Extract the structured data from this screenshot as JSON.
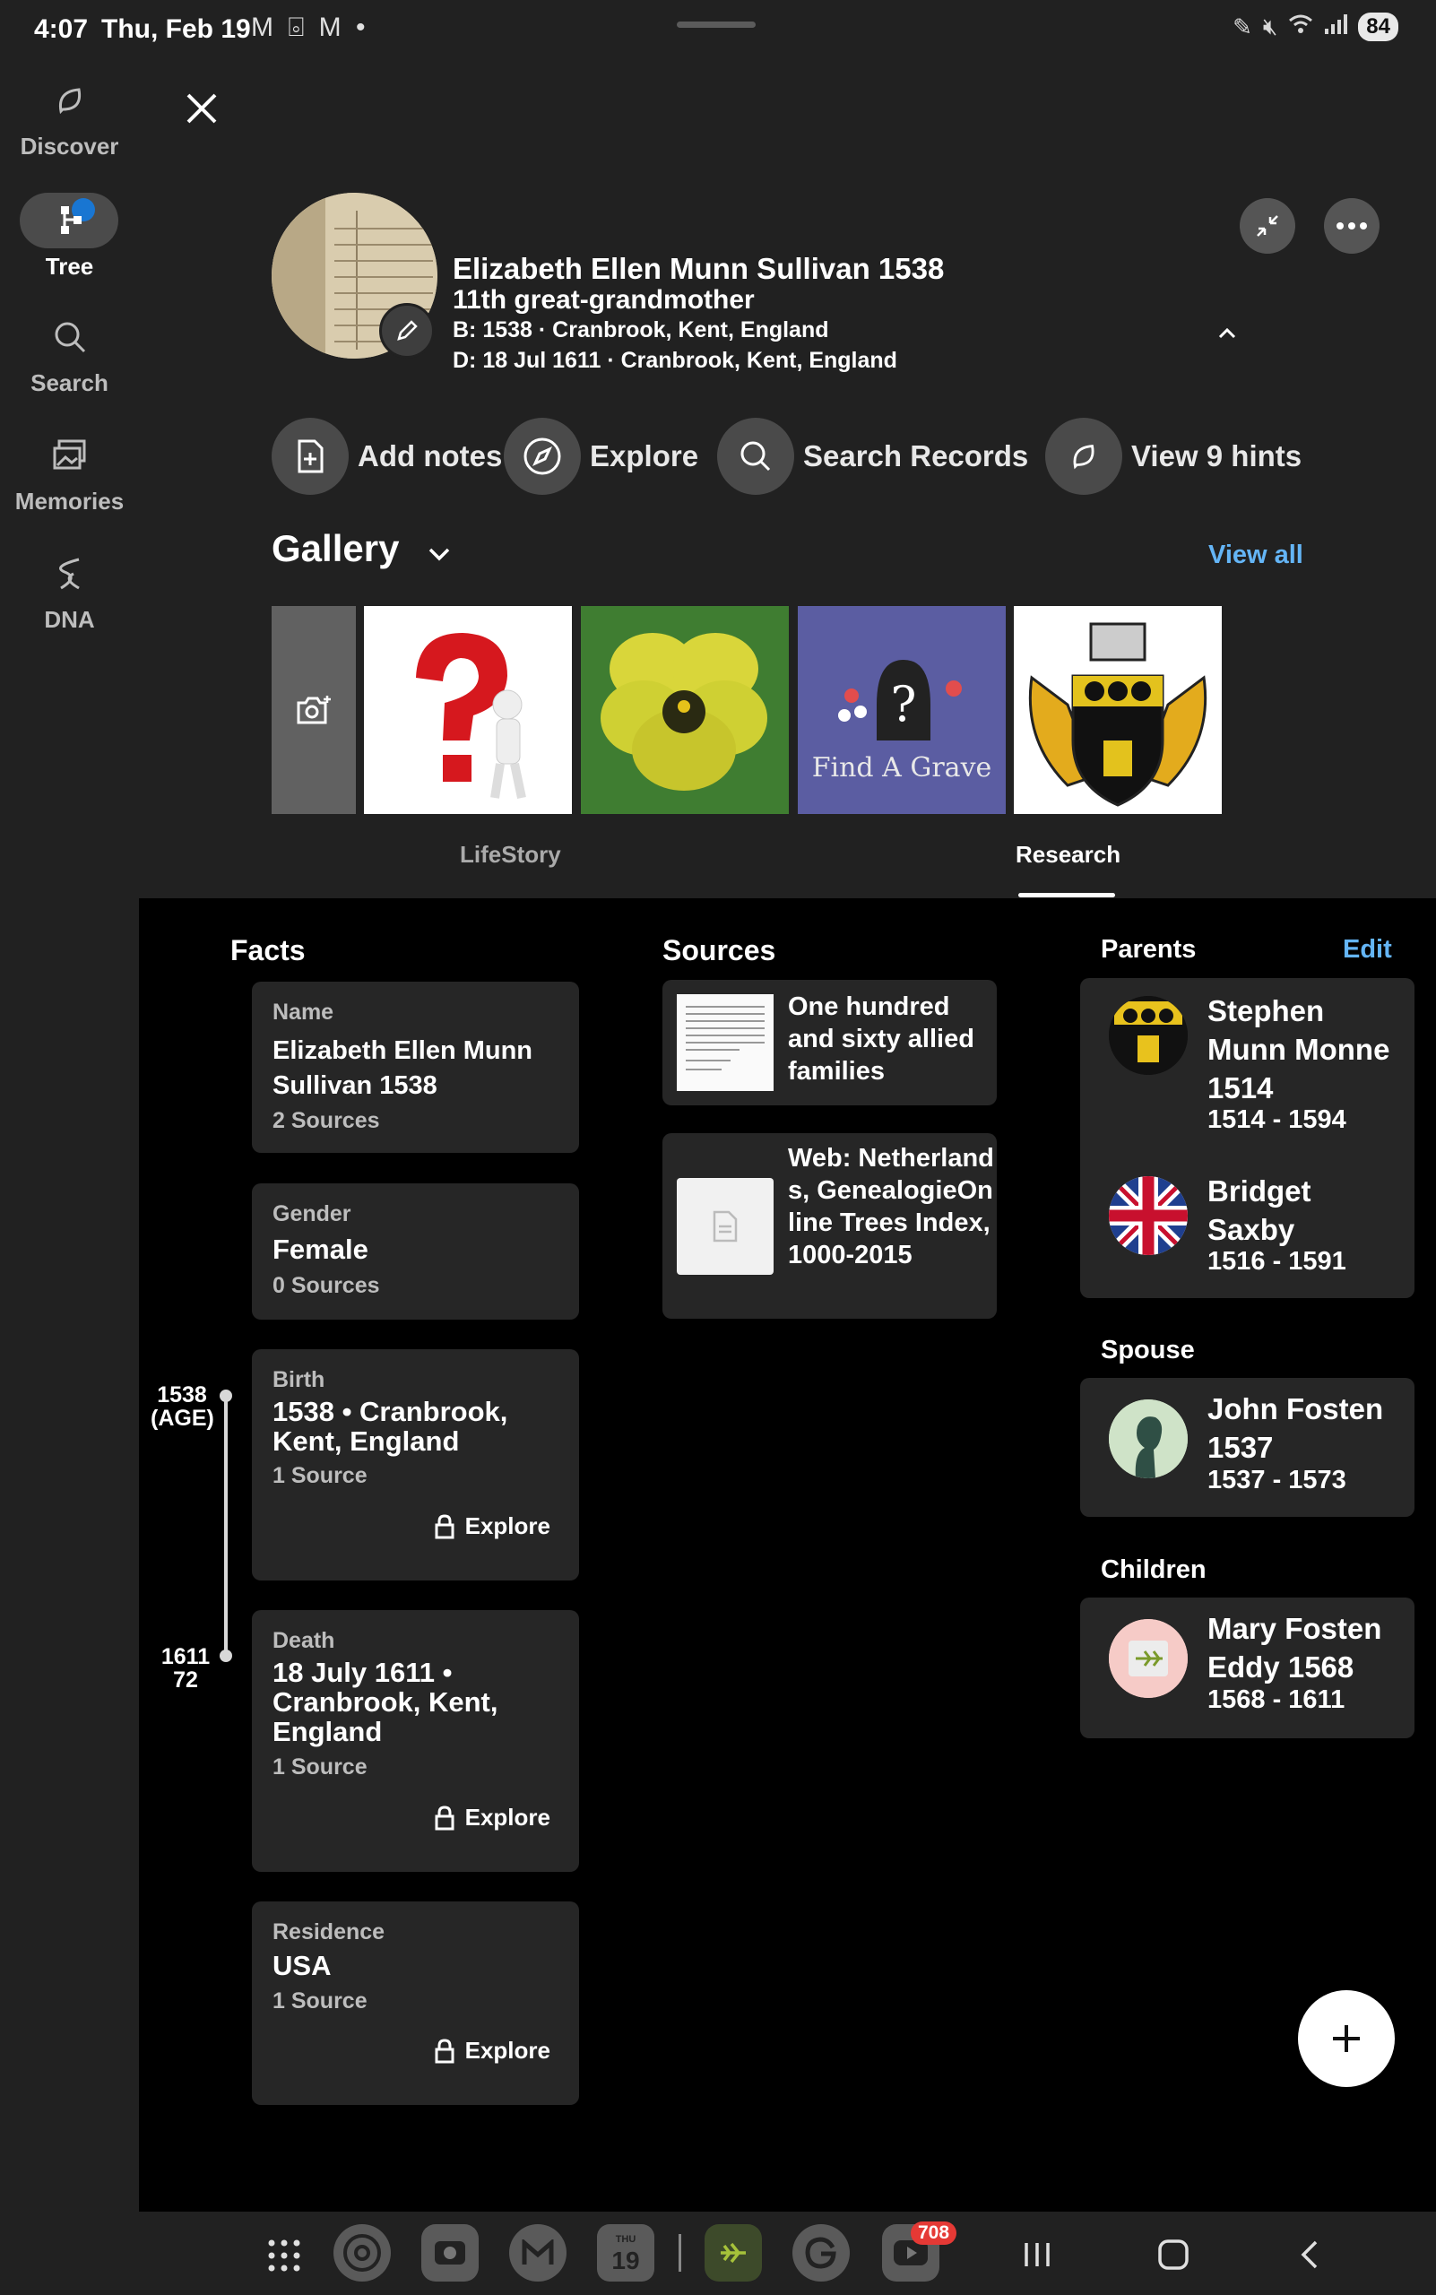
{
  "status_bar": {
    "time": "4:07",
    "date": "Thu, Feb 19",
    "left_icons": "M ⌻ M •",
    "battery": "84"
  },
  "rail": {
    "items": [
      {
        "label": "Discover",
        "icon": "hint-leaf-icon"
      },
      {
        "label": "Tree",
        "icon": "tree-icon"
      },
      {
        "label": "Search",
        "icon": "search-icon"
      },
      {
        "label": "Memories",
        "icon": "photos-icon"
      },
      {
        "label": "DNA",
        "icon": "dna-icon"
      }
    ]
  },
  "person": {
    "name": "Elizabeth Ellen Munn Sullivan 1538",
    "relationship": "11th great-grandmother",
    "birth": "B: 1538 · Cranbrook, Kent, England",
    "death": "D: 18 Jul 1611 · Cranbrook, Kent, England"
  },
  "actions": [
    {
      "label": "Add notes",
      "icon": "add-note-icon"
    },
    {
      "label": "Explore",
      "icon": "compass-icon"
    },
    {
      "label": "Search Records",
      "icon": "search-icon"
    },
    {
      "label": "View 9 hints",
      "icon": "hint-leaf-icon"
    }
  ],
  "gallery": {
    "title": "Gallery",
    "view_all": "View all",
    "thumb_findagrave_text": "Find A Grave"
  },
  "tabs": {
    "lifestory": "LifeStory",
    "research": "Research",
    "active": "Research"
  },
  "facts": {
    "heading": "Facts",
    "items": [
      {
        "label": "Name",
        "value": "Elizabeth Ellen Munn Sullivan 1538",
        "sources": "2 Sources"
      },
      {
        "label": "Gender",
        "value": "Female",
        "sources": "0 Sources"
      },
      {
        "label": "Birth",
        "value": "1538 • Cranbrook, Kent, England",
        "sources": "1 Source",
        "explore": "Explore"
      },
      {
        "label": "Death",
        "value": "18 July 1611 • Cranbrook, Kent, England",
        "sources": "1 Source",
        "explore": "Explore"
      },
      {
        "label": "Residence",
        "value": "USA",
        "sources": "1 Source",
        "explore": "Explore"
      }
    ]
  },
  "timeline": {
    "start_year": "1538",
    "start_age": "(AGE)",
    "end_year": "1611",
    "end_age": "72"
  },
  "sources": {
    "heading": "Sources",
    "items": [
      {
        "title": "One hundred and sixty allied families"
      },
      {
        "title": "Web: Netherlands, GenealogieOnline Trees Index, 1000-2015"
      }
    ]
  },
  "relations": {
    "parents_heading": "Parents",
    "edit": "Edit",
    "parents": [
      {
        "name": "Stephen Munn Monne 1514",
        "years": "1514 - 1594"
      },
      {
        "name": "Bridget Saxby",
        "years": "1516 - 1591"
      }
    ],
    "spouse_heading": "Spouse",
    "spouse": {
      "name": "John Fosten 1537",
      "years": "1537 - 1573"
    },
    "children_heading": "Children",
    "children": [
      {
        "name": "Mary Fosten Eddy 1568",
        "years": "1568 - 1611"
      }
    ]
  },
  "dock": {
    "calendar_day": "19",
    "calendar_dow": "THU",
    "youtube_badge": "708"
  },
  "colors": {
    "accent_blue": "#64b5f6",
    "panel_bg": "#000000",
    "app_bg": "#212121",
    "card_bg": "#262626"
  }
}
